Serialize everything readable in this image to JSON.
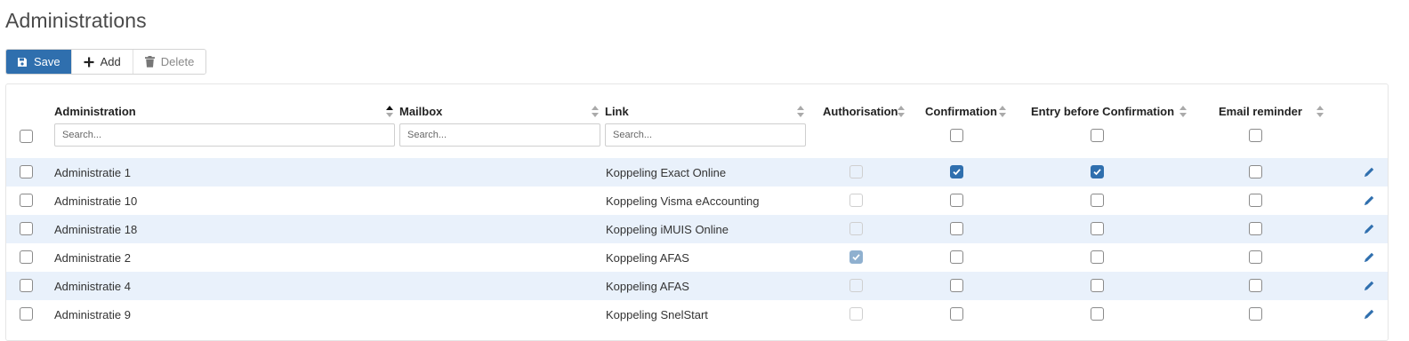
{
  "page": {
    "title": "Administrations"
  },
  "toolbar": {
    "save_label": "Save",
    "add_label": "Add",
    "delete_label": "Delete"
  },
  "colors": {
    "primary": "#2f6fae",
    "stripe": "#e9f1fb"
  },
  "columns": {
    "administration": "Administration",
    "mailbox": "Mailbox",
    "link": "Link",
    "authorisation": "Authorisation",
    "confirmation": "Confirmation",
    "entry_before_confirmation": "Entry before Confirmation",
    "email_reminder": "Email reminder"
  },
  "filters": {
    "administration_placeholder": "Search...",
    "mailbox_placeholder": "Search...",
    "link_placeholder": "Search..."
  },
  "rows": [
    {
      "administration": "Administratie 1",
      "mailbox": "",
      "link": "Koppeling Exact Online",
      "authorisation": false,
      "confirmation": true,
      "entry_before_confirmation": true,
      "email_reminder": false
    },
    {
      "administration": "Administratie 10",
      "mailbox": "",
      "link": "Koppeling Visma eAccounting",
      "authorisation": false,
      "confirmation": false,
      "entry_before_confirmation": false,
      "email_reminder": false
    },
    {
      "administration": "Administratie 18",
      "mailbox": "",
      "link": "Koppeling iMUIS Online",
      "authorisation": false,
      "confirmation": false,
      "entry_before_confirmation": false,
      "email_reminder": false
    },
    {
      "administration": "Administratie 2",
      "mailbox": "",
      "link": "Koppeling AFAS",
      "authorisation": true,
      "confirmation": false,
      "entry_before_confirmation": false,
      "email_reminder": false
    },
    {
      "administration": "Administratie 4",
      "mailbox": "",
      "link": "Koppeling AFAS",
      "authorisation": false,
      "confirmation": false,
      "entry_before_confirmation": false,
      "email_reminder": false
    },
    {
      "administration": "Administratie 9",
      "mailbox": "",
      "link": "Koppeling SnelStart",
      "authorisation": false,
      "confirmation": false,
      "entry_before_confirmation": false,
      "email_reminder": false
    }
  ],
  "icons": {
    "save": "save-icon",
    "add": "plus-icon",
    "delete": "trash-icon",
    "edit": "pencil-icon",
    "sort": "sort-icon"
  }
}
